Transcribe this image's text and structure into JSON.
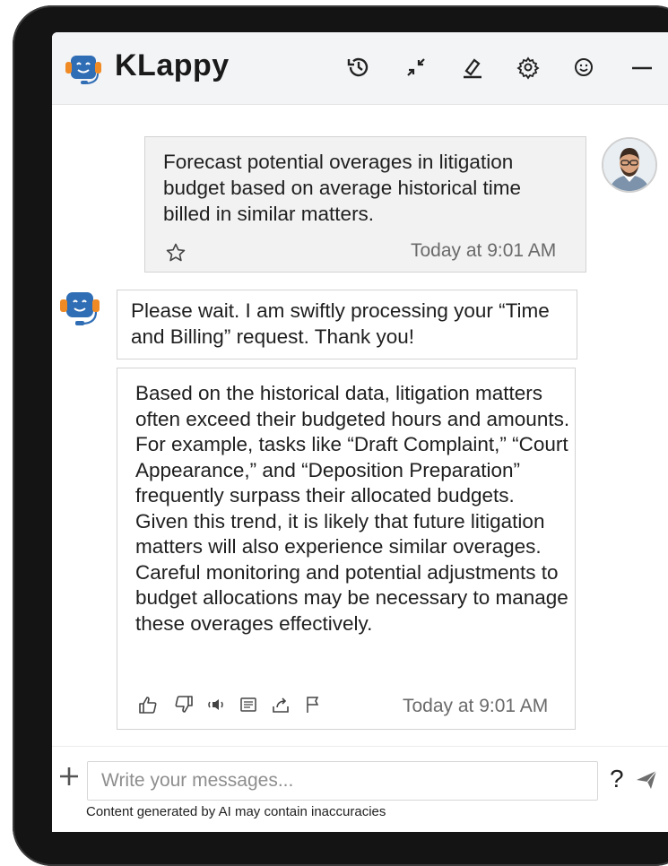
{
  "app": {
    "name": "KLappy"
  },
  "header": {
    "icons": [
      "history-icon",
      "collapse-icon",
      "clear-chat-icon",
      "settings-icon",
      "emoji-icon",
      "minimize-icon"
    ]
  },
  "messages": {
    "user": {
      "text": "Forecast potential overages in litigation budget based on average historical time billed in similar matters.",
      "timestamp": "Today at 9:01 AM"
    },
    "bot_status": {
      "text": "Please wait. I am swiftly processing your “Time and Billing” request. Thank you!"
    },
    "bot_answer": {
      "text": "Based on the historical data, litigation matters often exceed their budgeted hours and amounts. For example, tasks like “Draft Complaint,” “Court Appearance,” and “Deposition Preparation” frequently surpass their allocated budgets. Given this trend, it is likely that future litigation matters will also experience similar overages. Careful monitoring and potential adjustments to budget allocations may be necessary to manage these overages effectively.",
      "timestamp": "Today at 9:01 AM",
      "actions": [
        "thumbs-up-icon",
        "thumbs-down-icon",
        "speaker-icon",
        "notes-icon",
        "share-icon",
        "flag-icon"
      ]
    }
  },
  "composer": {
    "placeholder": "Write your messages...",
    "help_label": "?",
    "disclaimer": "Content generated by AI may contain inaccuracies"
  },
  "colors": {
    "header_bg": "#f3f4f6",
    "bot_blue": "#2f6db5",
    "headset_orange": "#f08a24"
  }
}
